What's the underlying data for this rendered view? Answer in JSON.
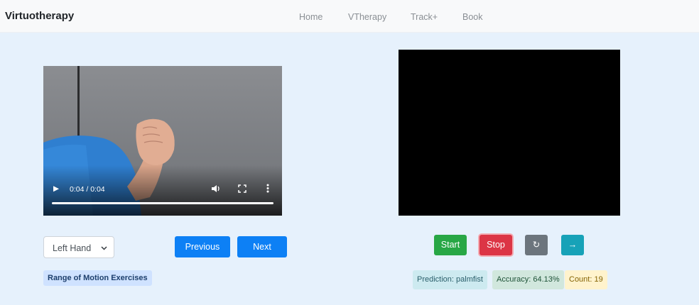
{
  "navbar": {
    "brand": "Virtuotherapy",
    "links": [
      "Home",
      "VTherapy",
      "Track+",
      "Book"
    ]
  },
  "video": {
    "time": "0:04 / 0:04",
    "progress_fraction": 1.0
  },
  "hand_select": {
    "value": "Left Hand",
    "chevron": "⌄"
  },
  "buttons": {
    "previous": "Previous",
    "next": "Next",
    "start": "Start",
    "stop": "Stop",
    "reset_icon": "↻",
    "forward_icon": "→"
  },
  "exercise_heading": "Range of Motion Exercises",
  "status": {
    "prediction": "Prediction: palmfist",
    "accuracy": "Accuracy: 64.13%",
    "count": "Count: 19"
  },
  "colors": {
    "page_bg": "#e6f1fc",
    "primary": "#0d80f5",
    "success": "#28a745",
    "danger": "#dc3545",
    "secondary": "#6c757d",
    "info": "#17a2b8"
  }
}
